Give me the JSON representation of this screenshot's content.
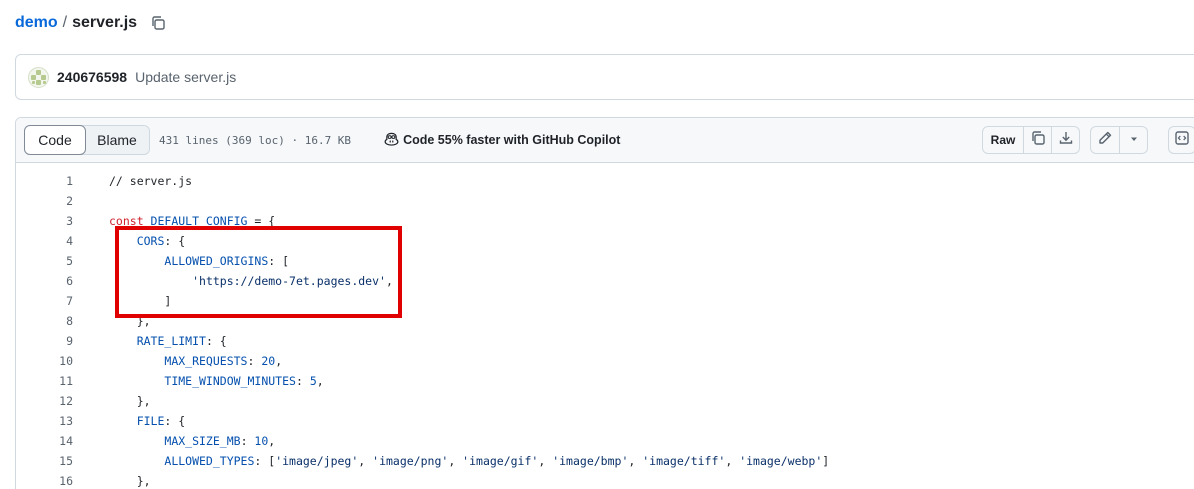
{
  "breadcrumb": {
    "repo": "demo",
    "separator": "/",
    "file": "server.js"
  },
  "commit": {
    "user": "240676598",
    "message": "Update server.js"
  },
  "file_header": {
    "tab_code": "Code",
    "tab_blame": "Blame",
    "info": "431 lines (369 loc) · 16.7 KB",
    "copilot": "Code 55% faster with GitHub Copilot",
    "raw_label": "Raw"
  },
  "code": [
    {
      "n": "1",
      "tokens": [
        [
          "pl",
          "// server.js"
        ]
      ]
    },
    {
      "n": "2",
      "tokens": []
    },
    {
      "n": "3",
      "tokens": [
        [
          "kw",
          "const "
        ],
        [
          "id",
          "DEFAULT_CONFIG"
        ],
        [
          "pl",
          " = {"
        ]
      ]
    },
    {
      "n": "4",
      "tokens": [
        [
          "pl",
          "    "
        ],
        [
          "id",
          "CORS"
        ],
        [
          "pl",
          ": {"
        ]
      ]
    },
    {
      "n": "5",
      "tokens": [
        [
          "pl",
          "        "
        ],
        [
          "id",
          "ALLOWED_ORIGINS"
        ],
        [
          "pl",
          ": ["
        ]
      ]
    },
    {
      "n": "6",
      "tokens": [
        [
          "pl",
          "            "
        ],
        [
          "str",
          "'https://demo-7et.pages.dev'"
        ],
        [
          "pl",
          ","
        ]
      ]
    },
    {
      "n": "7",
      "tokens": [
        [
          "pl",
          "        ]"
        ]
      ]
    },
    {
      "n": "8",
      "tokens": [
        [
          "pl",
          "    },"
        ]
      ]
    },
    {
      "n": "9",
      "tokens": [
        [
          "pl",
          "    "
        ],
        [
          "id",
          "RATE_LIMIT"
        ],
        [
          "pl",
          ": {"
        ]
      ]
    },
    {
      "n": "10",
      "tokens": [
        [
          "pl",
          "        "
        ],
        [
          "id",
          "MAX_REQUESTS"
        ],
        [
          "pl",
          ": "
        ],
        [
          "id",
          "20"
        ],
        [
          "pl",
          ","
        ]
      ]
    },
    {
      "n": "11",
      "tokens": [
        [
          "pl",
          "        "
        ],
        [
          "id",
          "TIME_WINDOW_MINUTES"
        ],
        [
          "pl",
          ": "
        ],
        [
          "id",
          "5"
        ],
        [
          "pl",
          ","
        ]
      ]
    },
    {
      "n": "12",
      "tokens": [
        [
          "pl",
          "    },"
        ]
      ]
    },
    {
      "n": "13",
      "tokens": [
        [
          "pl",
          "    "
        ],
        [
          "id",
          "FILE"
        ],
        [
          "pl",
          ": {"
        ]
      ]
    },
    {
      "n": "14",
      "tokens": [
        [
          "pl",
          "        "
        ],
        [
          "id",
          "MAX_SIZE_MB"
        ],
        [
          "pl",
          ": "
        ],
        [
          "id",
          "10"
        ],
        [
          "pl",
          ","
        ]
      ]
    },
    {
      "n": "15",
      "tokens": [
        [
          "pl",
          "        "
        ],
        [
          "id",
          "ALLOWED_TYPES"
        ],
        [
          "pl",
          ": ["
        ],
        [
          "str",
          "'image/jpeg'"
        ],
        [
          "pl",
          ", "
        ],
        [
          "str",
          "'image/png'"
        ],
        [
          "pl",
          ", "
        ],
        [
          "str",
          "'image/gif'"
        ],
        [
          "pl",
          ", "
        ],
        [
          "str",
          "'image/bmp'"
        ],
        [
          "pl",
          ", "
        ],
        [
          "str",
          "'image/tiff'"
        ],
        [
          "pl",
          ", "
        ],
        [
          "str",
          "'image/webp'"
        ],
        [
          "pl",
          "]"
        ]
      ]
    },
    {
      "n": "16",
      "tokens": [
        [
          "pl",
          "    },"
        ]
      ]
    }
  ],
  "icons": {
    "copy_path": "copy-icon",
    "copilot": "copilot-icon",
    "copy_raw": "copy-icon",
    "download": "download-icon",
    "edit": "pencil-icon",
    "more": "triangle-down-icon",
    "symbols": "code-square-icon"
  },
  "colors": {
    "link": "#0969da",
    "keyword": "#cf222e",
    "identifier": "#0550ae",
    "string": "#0a3069",
    "highlight_box": "#e00000"
  }
}
